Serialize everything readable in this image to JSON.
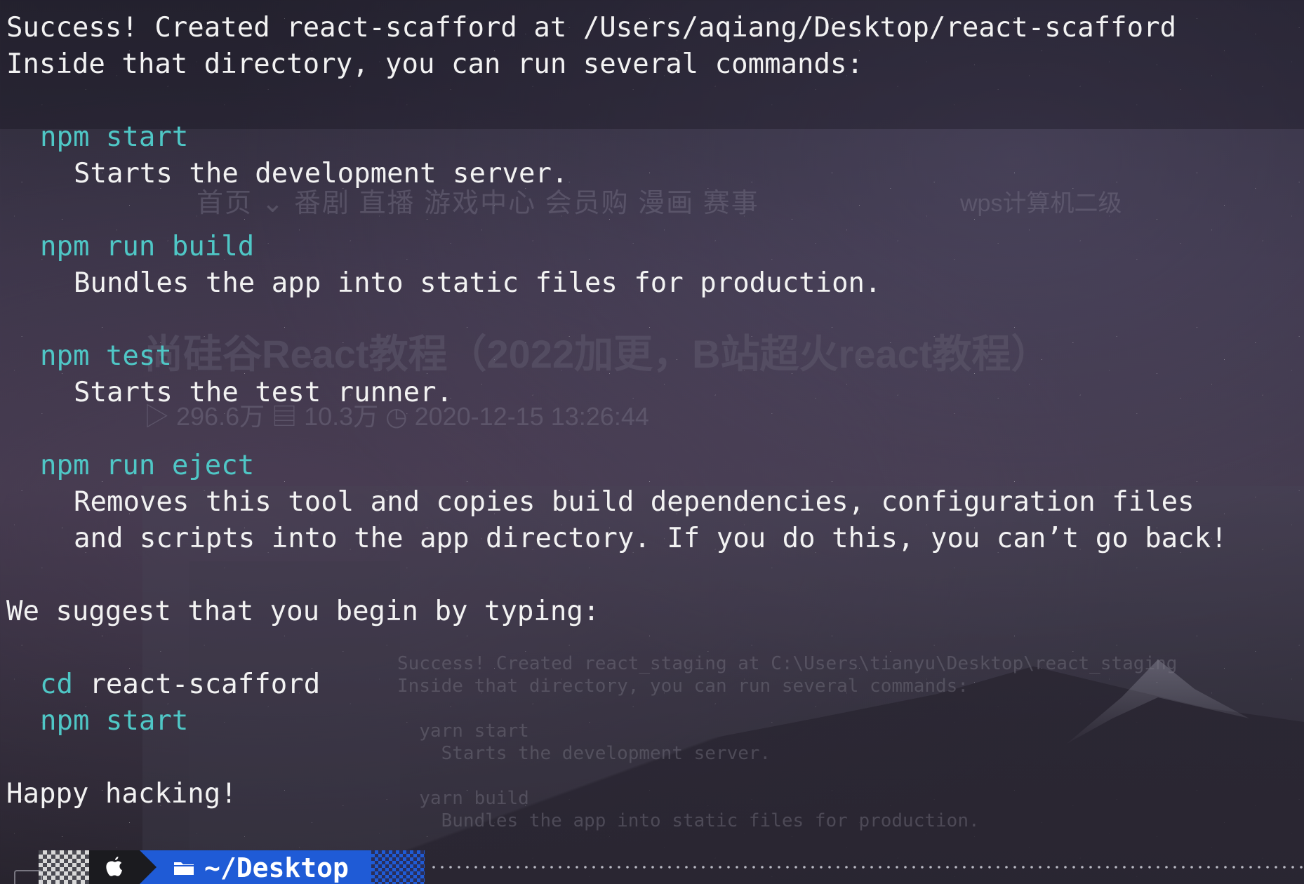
{
  "terminal": {
    "lines": [
      {
        "kind": "text",
        "text": "Success! Created react-scafford at /Users/aqiang/Desktop/react-scafford"
      },
      {
        "kind": "text",
        "text": "Inside that directory, you can run several commands:"
      },
      {
        "kind": "blank",
        "text": ""
      },
      {
        "kind": "cmd",
        "text": "npm start"
      },
      {
        "kind": "desc",
        "text": "Starts the development server."
      },
      {
        "kind": "blank",
        "text": ""
      },
      {
        "kind": "cmd",
        "text": "npm run build"
      },
      {
        "kind": "desc",
        "text": "Bundles the app into static files for production."
      },
      {
        "kind": "blank",
        "text": ""
      },
      {
        "kind": "cmd",
        "text": "npm test"
      },
      {
        "kind": "desc",
        "text": "Starts the test runner."
      },
      {
        "kind": "blank",
        "text": ""
      },
      {
        "kind": "cmd",
        "text": "npm run eject"
      },
      {
        "kind": "desc",
        "text": "Removes this tool and copies build dependencies, configuration files"
      },
      {
        "kind": "desc",
        "text": "and scripts into the app directory. If you do this, you can’t go back!"
      },
      {
        "kind": "blank",
        "text": ""
      },
      {
        "kind": "text",
        "text": "We suggest that you begin by typing:"
      },
      {
        "kind": "blank",
        "text": ""
      },
      {
        "kind": "cdline",
        "cmd": "cd",
        "arg": " react-scafford"
      },
      {
        "kind": "cmd",
        "text": "npm start"
      },
      {
        "kind": "blank",
        "text": ""
      },
      {
        "kind": "text",
        "text": "Happy hacking!"
      }
    ]
  },
  "prompt": {
    "os_icon": "apple-icon",
    "folder_icon": "folder-icon",
    "directory": "~/Desktop"
  },
  "colors": {
    "command": "#4fc7c6",
    "text": "#f2f2f2",
    "prompt_dir_bg": "#1f5bd6"
  },
  "background": {
    "bili_nav": "首页 ⌄  番剧  直播  游戏中心  会员购  漫画  赛事",
    "bili_search": "wps计算机二级",
    "video_title": "尚硅谷React教程（2022加更，B站超火react教程）",
    "video_meta": "▷ 296.6万   ▤ 10.3万   ◷ 2020-12-15 13:26:44",
    "ghost_terminal": "Success! Created react_staging at C:\\Users\\tianyu\\Desktop\\react_staging\nInside that directory, you can run several commands:\n\n  yarn start\n    Starts the development server.\n\n  yarn build\n    Bundles the app into static files for production."
  }
}
